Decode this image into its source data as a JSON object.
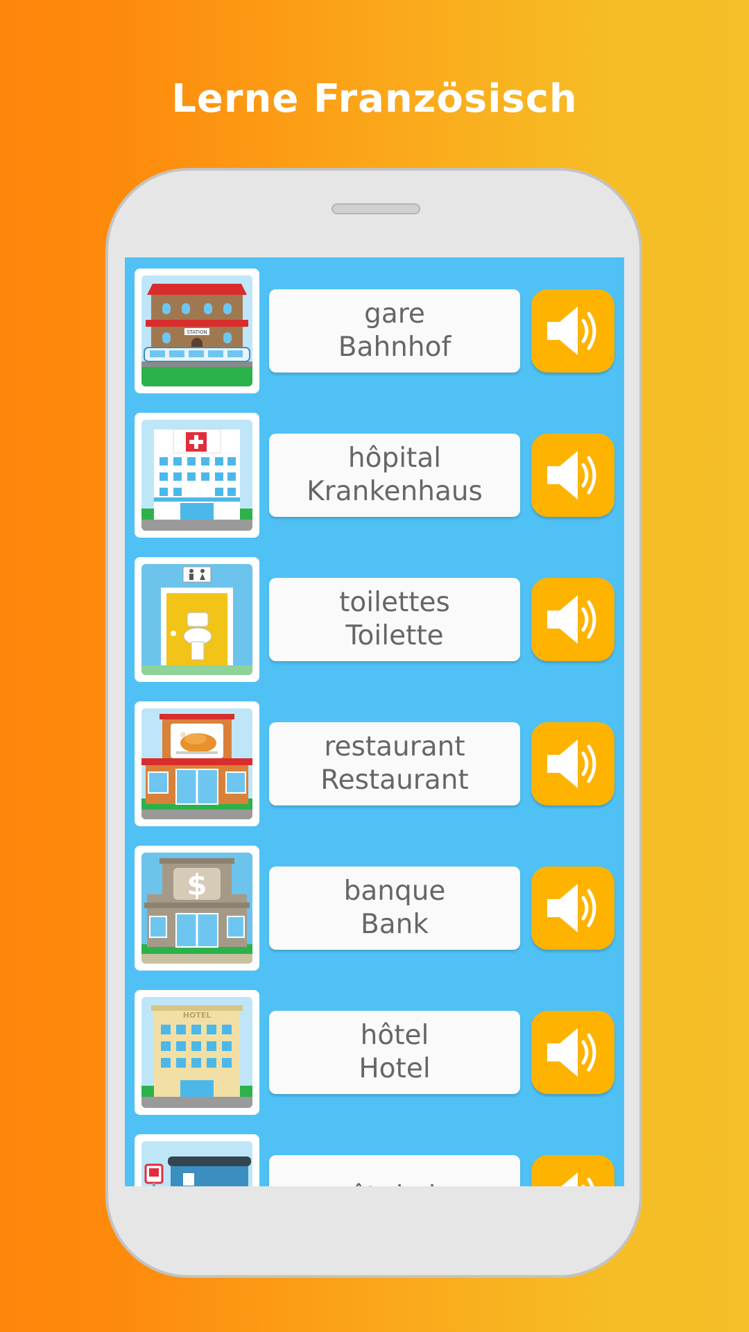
{
  "header": {
    "title": "Lerne Französisch"
  },
  "vocab": [
    {
      "french": "gare",
      "german": "Bahnhof",
      "icon": "train-station-icon"
    },
    {
      "french": "hôpital",
      "german": "Krankenhaus",
      "icon": "hospital-icon"
    },
    {
      "french": "toilettes",
      "german": "Toilette",
      "icon": "toilet-icon"
    },
    {
      "french": "restaurant",
      "german": "Restaurant",
      "icon": "restaurant-icon"
    },
    {
      "french": "banque",
      "german": "Bank",
      "icon": "bank-icon"
    },
    {
      "french": "hôtel",
      "german": "Hotel",
      "icon": "hotel-icon"
    },
    {
      "french": "arrêt de bus",
      "german": "",
      "icon": "bus-stop-icon"
    }
  ],
  "labels": {
    "station_sign": "STATION",
    "hotel_sign": "HOTEL",
    "bank_sign": "$"
  },
  "colors": {
    "screen_bg": "#4fc1f4",
    "sound_button": "#feb300",
    "word_text": "#666666"
  }
}
